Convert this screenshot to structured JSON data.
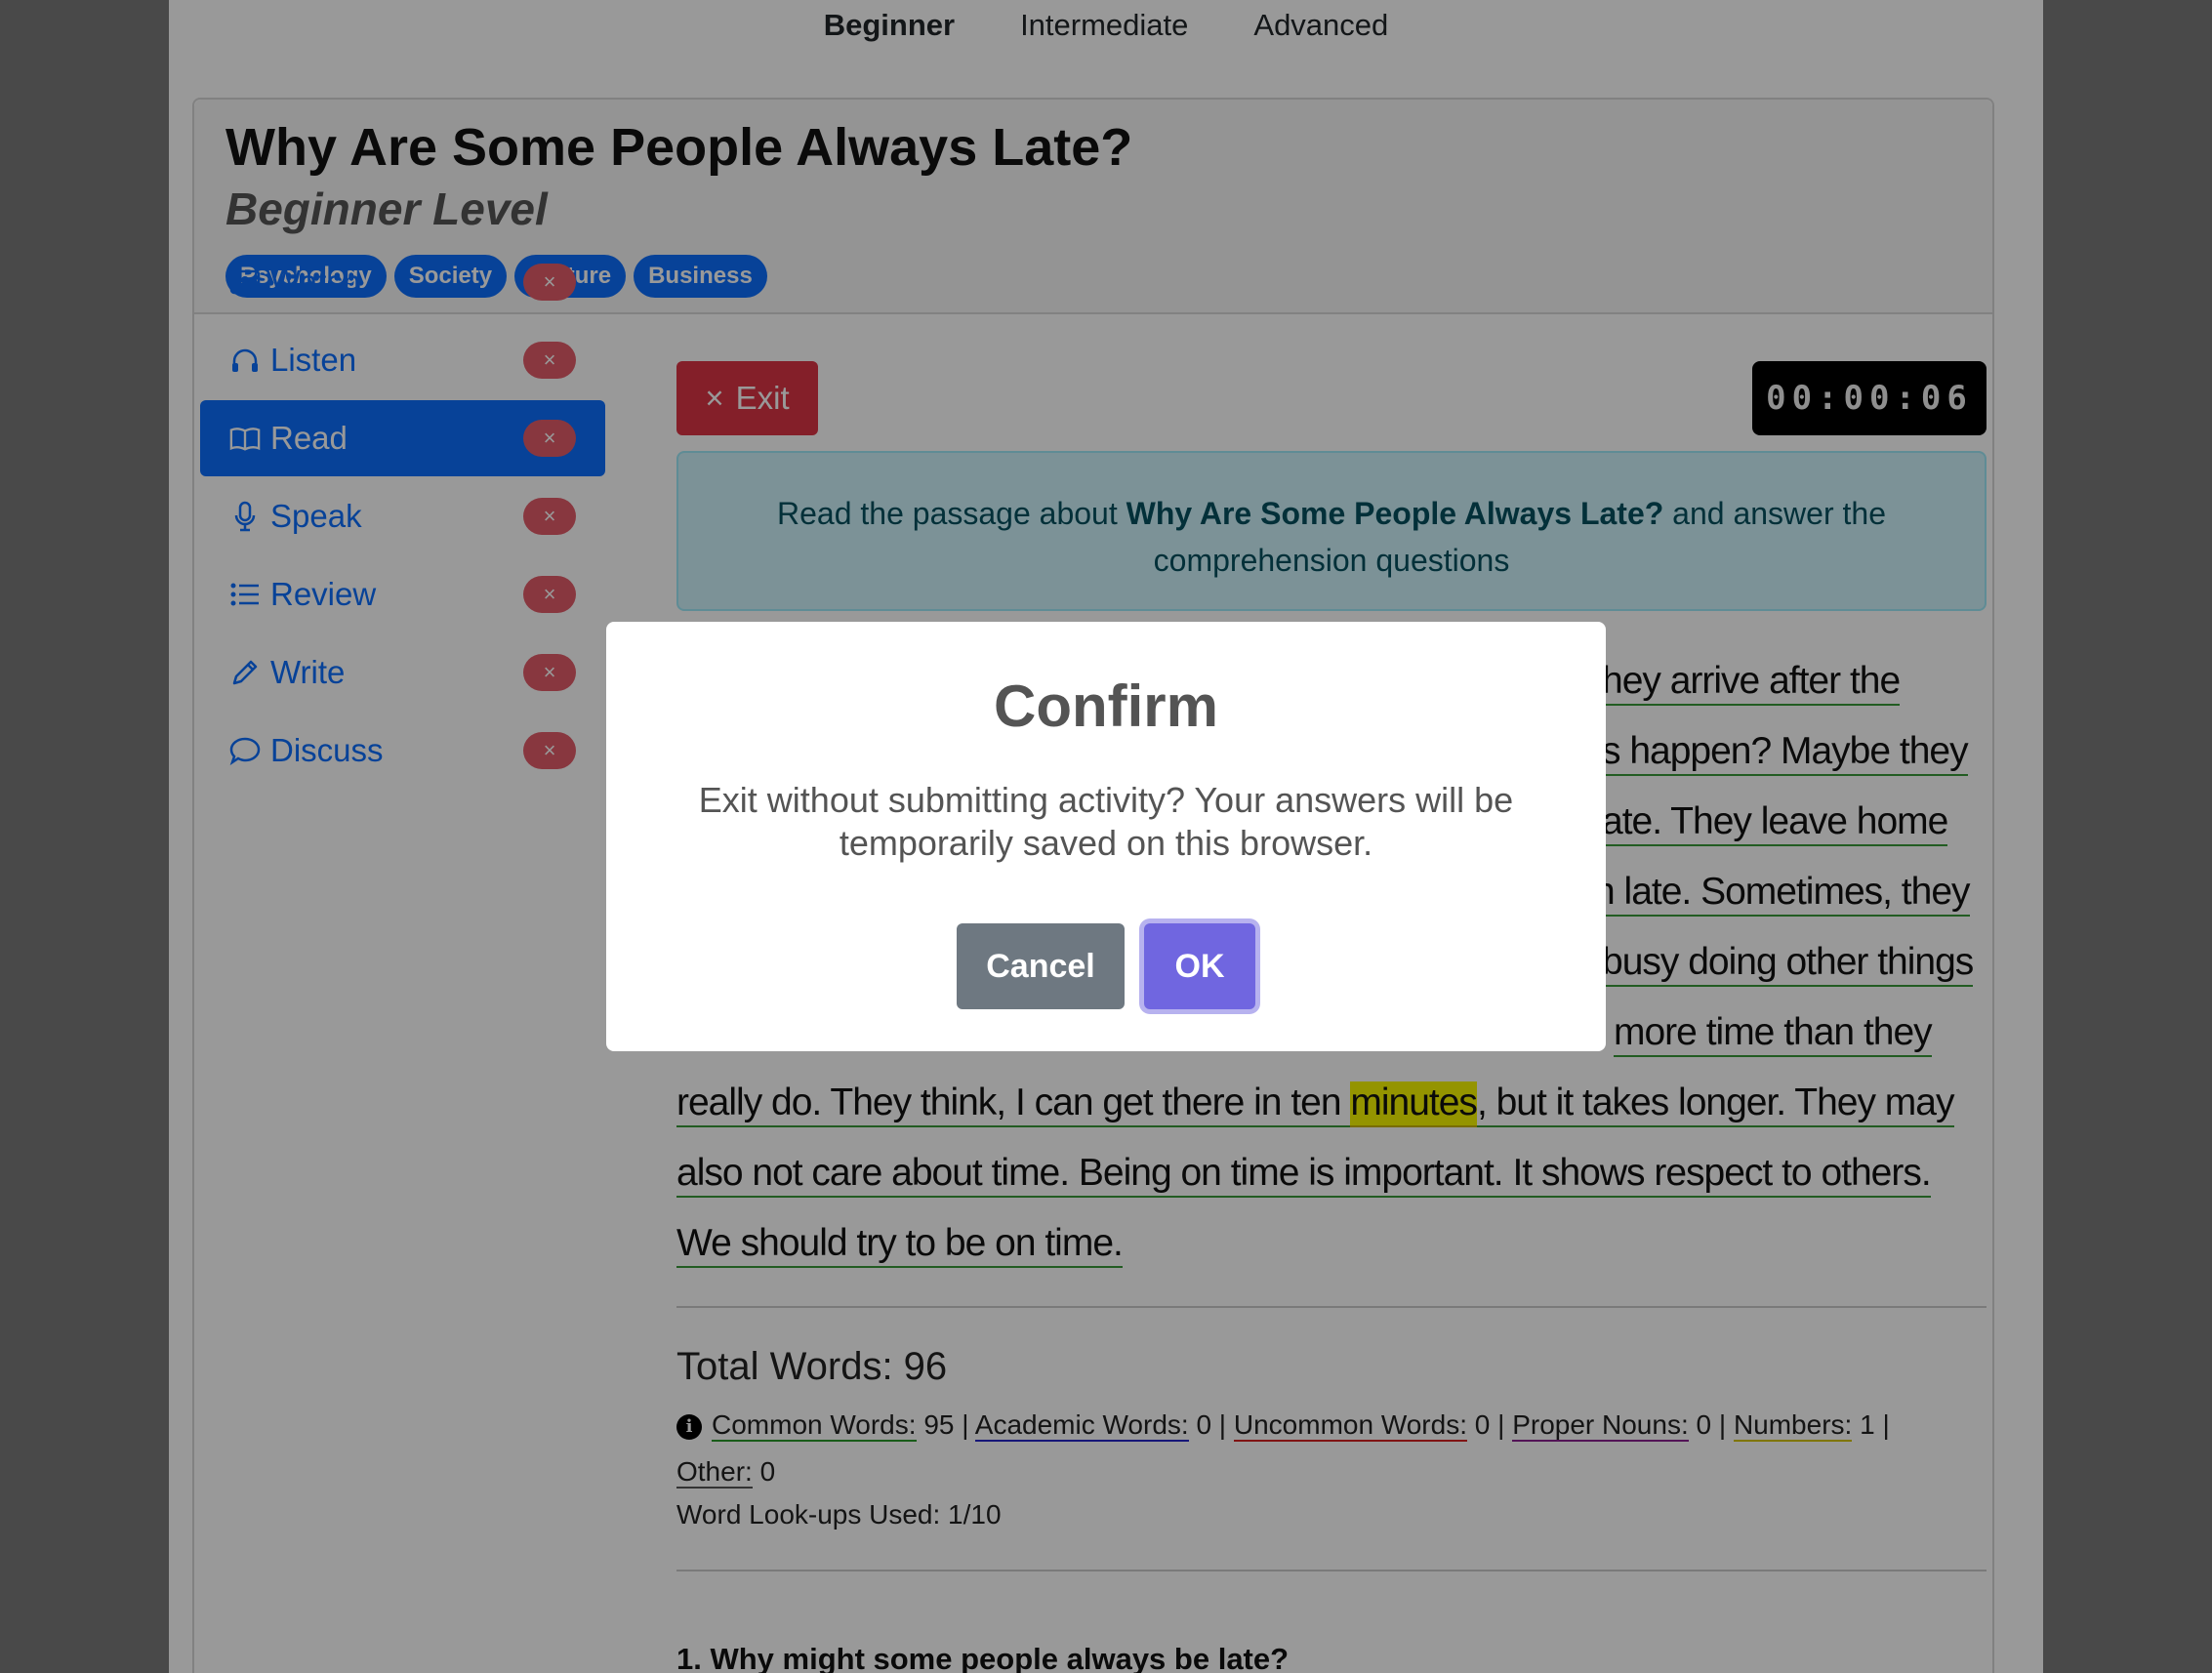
{
  "level_nav": {
    "beginner": "Beginner",
    "intermediate": "Intermediate",
    "advanced": "Advanced",
    "active": "Beginner"
  },
  "header": {
    "title": "Why Are Some People Always Late?",
    "subtitle": "Beginner Level",
    "tags": [
      "Psychology",
      "Society",
      "Culture",
      "Business"
    ]
  },
  "sidebar": {
    "items": [
      {
        "label": "Watch",
        "icon": "person-video-icon",
        "active": false
      },
      {
        "label": "Listen",
        "icon": "headphones-icon",
        "active": false
      },
      {
        "label": "Read",
        "icon": "book-icon",
        "active": true
      },
      {
        "label": "Speak",
        "icon": "microphone-icon",
        "active": false
      },
      {
        "label": "Review",
        "icon": "list-icon",
        "active": false
      },
      {
        "label": "Write",
        "icon": "pencil-icon",
        "active": false
      },
      {
        "label": "Discuss",
        "icon": "chat-bubble-icon",
        "active": false
      }
    ],
    "badge": "×"
  },
  "main": {
    "exit_label": "Exit",
    "exit_icon": "×",
    "timer": "00:00:06",
    "instruction": {
      "prefix": "Read the passage about ",
      "topic": "Why Are Some People Always Late?",
      "suffix": " and answer the comprehension questions"
    },
    "passage_lines": [
      "hey arrive after the",
      "s happen? Maybe they",
      "ate. They leave home",
      "n late. Sometimes, they",
      "busy doing other things",
      "more time than they",
      "really do. They think, I can get there in ten minutes, but it takes longer. They may",
      "also not care about time. Being on time is important. It shows respect to others.",
      "We should try to be on time."
    ],
    "highlighted_word": "minutes",
    "total_words": "Total Words: 96",
    "stats": {
      "common_label": "Common Words:",
      "common": "95",
      "academic_label": "Academic Words:",
      "academic": "0",
      "uncommon_label": "Uncommon Words:",
      "uncommon": "0",
      "proper_label": "Proper Nouns:",
      "proper": "0",
      "numbers_label": "Numbers:",
      "numbers": "1",
      "other_label": "Other:",
      "other": "0"
    },
    "lookups": "Word Look-ups Used: 1/10",
    "question": "1. Why might some people always be late?"
  },
  "modal": {
    "title": "Confirm",
    "text": "Exit without submitting activity? Your answers will be temporarily saved on this browser.",
    "cancel": "Cancel",
    "ok": "OK"
  },
  "colors": {
    "primary": "#0d6efd",
    "danger": "#dc3545",
    "ok_button": "#7066e0",
    "cancel_button": "#6e7881",
    "info_bg": "#cff4fc"
  }
}
